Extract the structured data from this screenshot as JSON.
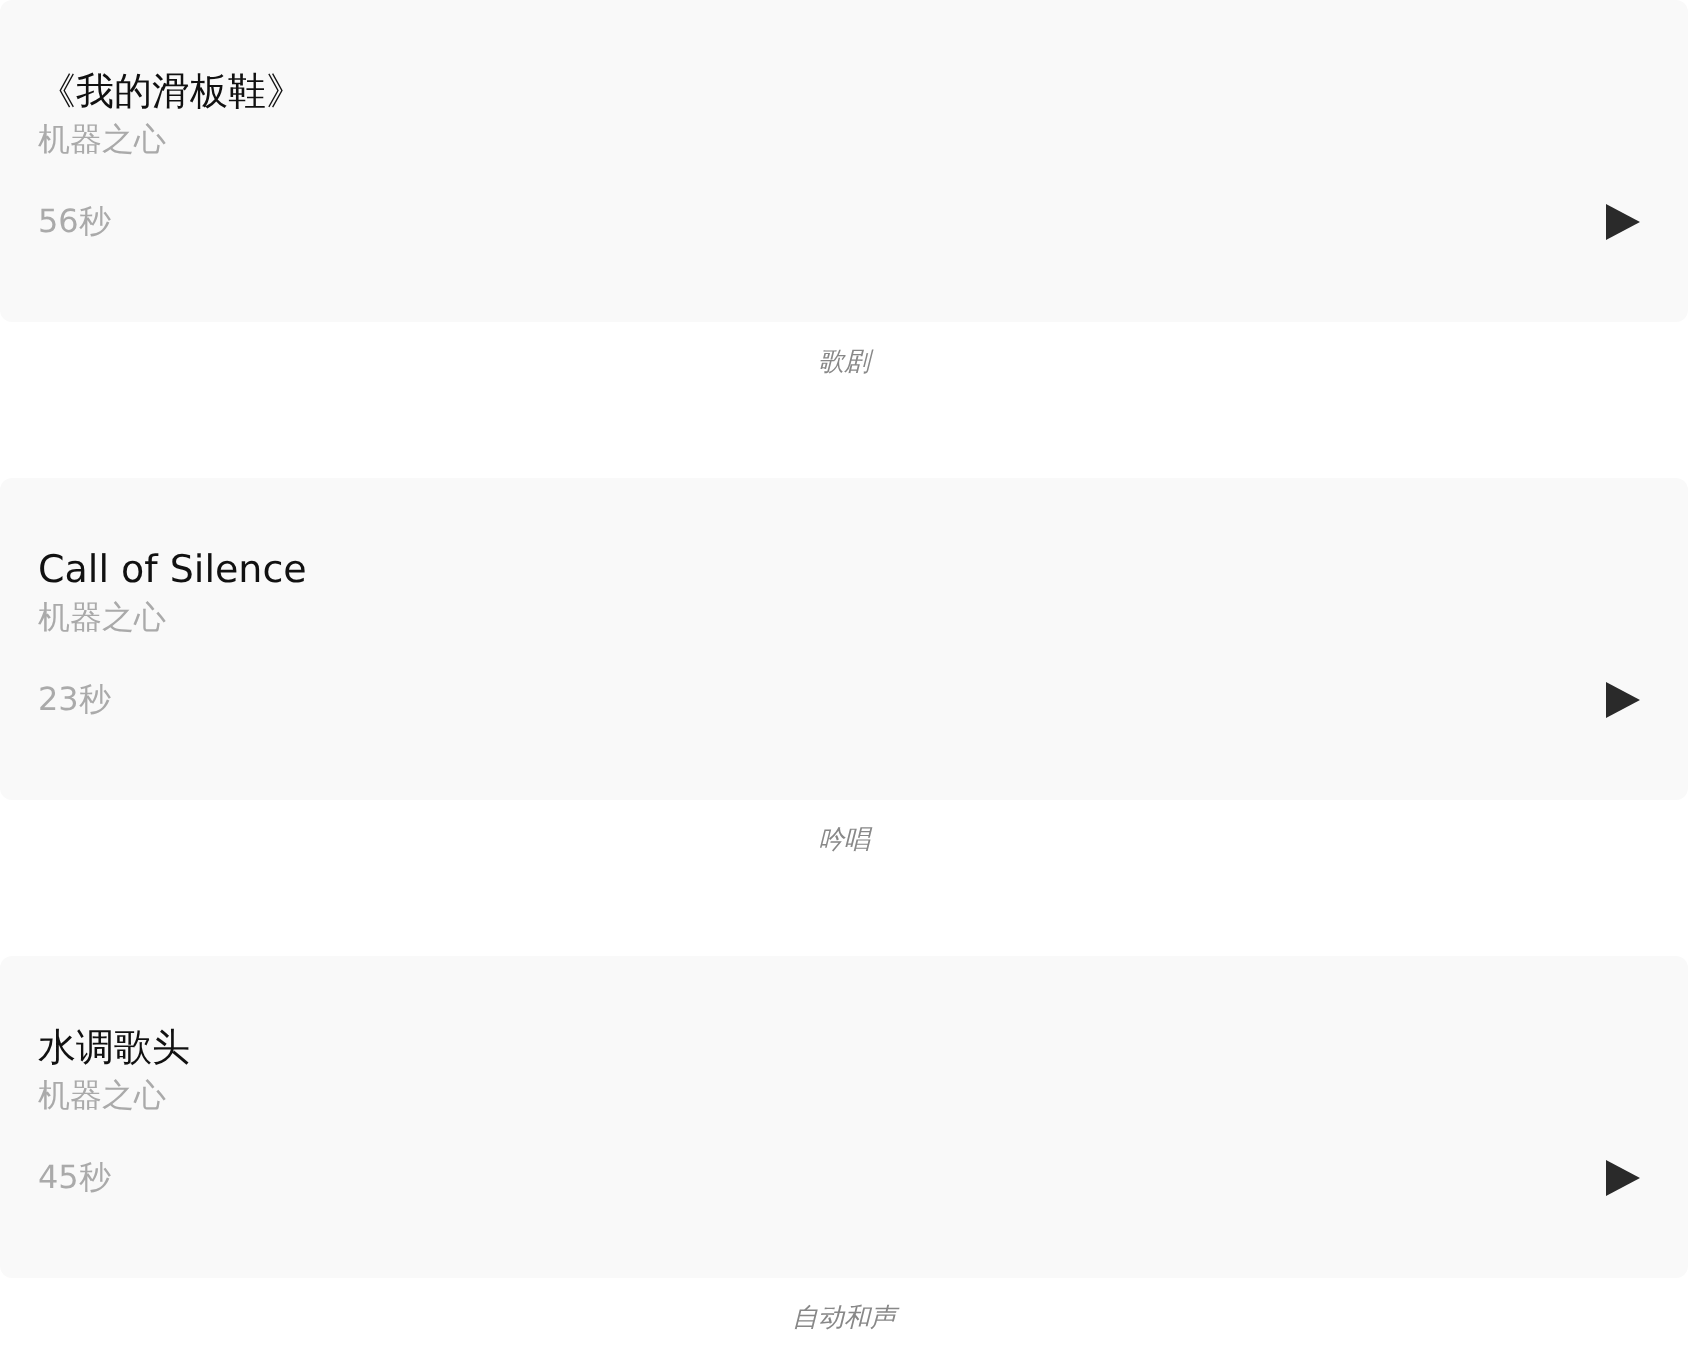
{
  "tracks": [
    {
      "title": "《我的滑板鞋》",
      "artist": "机器之心",
      "duration": "56秒",
      "caption": "歌剧"
    },
    {
      "title": "Call of Silence",
      "artist": "机器之心",
      "duration": "23秒",
      "caption": "吟唱"
    },
    {
      "title": "水调歌头",
      "artist": "机器之心",
      "duration": "45秒",
      "caption": "自动和声"
    }
  ]
}
